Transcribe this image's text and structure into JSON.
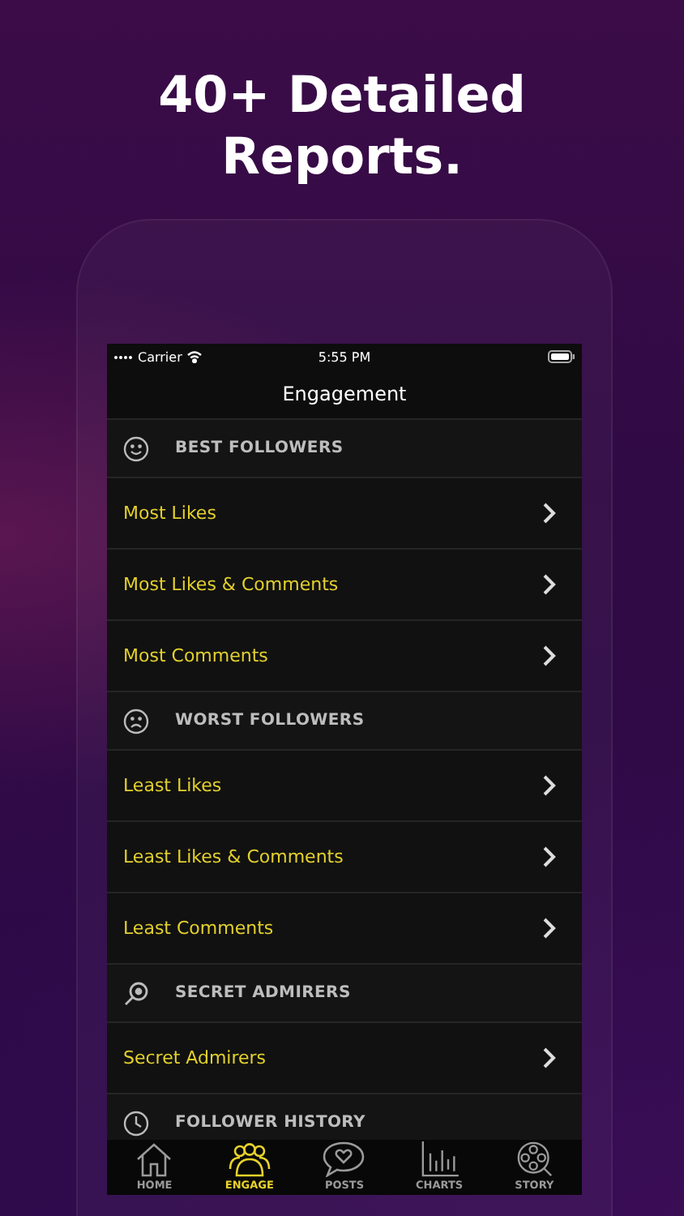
{
  "headline": "40+ Detailed Reports.",
  "status_bar": {
    "carrier": "Carrier",
    "time": "5:55 PM"
  },
  "nav": {
    "title": "Engagement"
  },
  "sections": [
    {
      "title": "BEST FOLLOWERS",
      "rows": [
        "Most Likes",
        "Most Likes & Comments",
        "Most Comments"
      ]
    },
    {
      "title": "WORST FOLLOWERS",
      "rows": [
        "Least Likes",
        "Least Likes & Comments",
        "Least Comments"
      ]
    },
    {
      "title": "SECRET ADMIRERS",
      "rows": [
        "Secret Admirers"
      ]
    },
    {
      "title": "FOLLOWER HISTORY"
    }
  ],
  "tabs": [
    {
      "label": "HOME",
      "selected": false
    },
    {
      "label": "ENGAGE",
      "selected": true
    },
    {
      "label": "POSTS",
      "selected": false
    },
    {
      "label": "CHARTS",
      "selected": false
    },
    {
      "label": "STORY",
      "selected": false
    }
  ]
}
